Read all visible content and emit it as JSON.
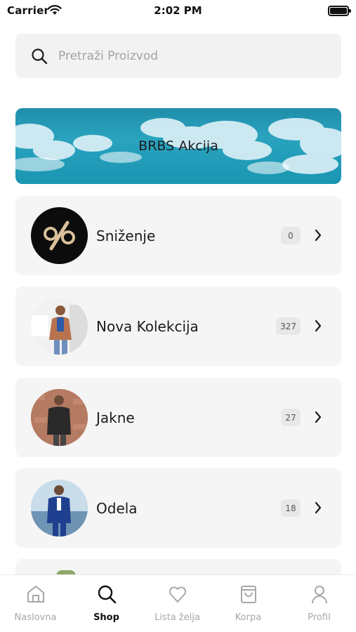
{
  "status_bar": {
    "carrier": "Carrier",
    "time": "2:02 PM"
  },
  "search": {
    "placeholder": "Pretraži Proizvod"
  },
  "banner": {
    "label": "BRBS Akcija"
  },
  "categories": [
    {
      "name": "Sniženje",
      "count": "0",
      "icon": "percent-icon"
    },
    {
      "name": "Nova Kolekcija",
      "count": "327",
      "icon": "model-photo"
    },
    {
      "name": "Jakne",
      "count": "27",
      "icon": "model-photo"
    },
    {
      "name": "Odela",
      "count": "18",
      "icon": "model-photo"
    }
  ],
  "tabs": [
    {
      "label": "Naslovna",
      "icon": "home-icon",
      "active": false
    },
    {
      "label": "Shop",
      "icon": "search-icon",
      "active": true
    },
    {
      "label": "Lista želja",
      "icon": "heart-icon",
      "active": false
    },
    {
      "label": "Korpa",
      "icon": "bag-icon",
      "active": false
    },
    {
      "label": "Profil",
      "icon": "user-icon",
      "active": false
    }
  ],
  "colors": {
    "accent": "#111111",
    "inactive": "#a7a7a7",
    "banner": "#2aa3bf",
    "card": "#f5f5f5"
  }
}
